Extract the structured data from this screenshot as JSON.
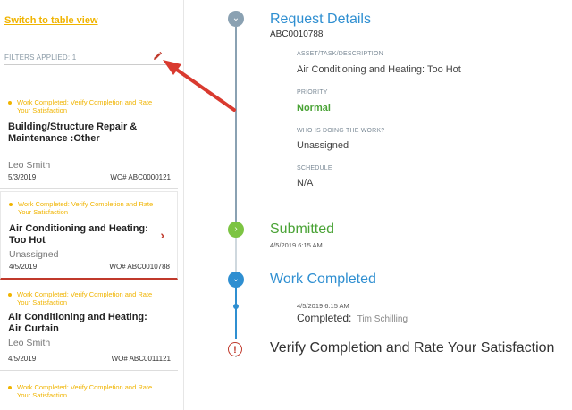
{
  "left_panel": {
    "switch_link": "Switch to table view",
    "filters_label": "FILTERS APPLIED: 1",
    "cards": [
      {
        "status": "Work Completed: Verify Completion and Rate Your Satisfaction",
        "title": "Building/Structure Repair & Maintenance :Other",
        "assignee": "Leo Smith",
        "date": "5/3/2019",
        "wo": "WO# ABC0000121"
      },
      {
        "status": "Work Completed: Verify Completion and Rate Your Satisfaction",
        "title": "Air Conditioning and Heating: Too Hot",
        "assignee": "Unassigned",
        "date": "4/5/2019",
        "wo": "WO# ABC0010788"
      },
      {
        "status": "Work Completed: Verify Completion and Rate Your Satisfaction",
        "title": "Air Conditioning and Heating: Air Curtain",
        "assignee": "Leo Smith",
        "date": "4/5/2019",
        "wo": "WO# ABC0011121"
      },
      {
        "status": "Work Completed: Verify Completion and Rate Your Satisfaction"
      }
    ]
  },
  "details": {
    "title": "Request Details",
    "request_id": "ABC0010788",
    "fields": [
      {
        "label": "ASSET/TASK/DESCRIPTION",
        "value": "Air Conditioning and Heating: Too Hot"
      },
      {
        "label": "PRIORITY",
        "value": "Normal"
      },
      {
        "label": "WHO IS DOING THE WORK?",
        "value": "Unassigned"
      },
      {
        "label": "SCHEDULE",
        "value": "N/A"
      }
    ]
  },
  "timeline": {
    "submitted": {
      "title": "Submitted",
      "timestamp": "4/5/2019 6:15 AM"
    },
    "work_completed": {
      "title": "Work Completed",
      "timestamp": "4/5/2019 6:15 AM",
      "completed_label": "Completed:",
      "completed_by": "Tim Schilling"
    },
    "verify": {
      "title": "Verify Completion and Rate Your Satisfaction"
    }
  },
  "colors": {
    "accent_yellow": "#f0b400",
    "priority_green": "#4aa336",
    "submitted_green": "#7cc443",
    "work_blue": "#2f8fd1",
    "alert_red": "#c0392b",
    "timeline_gray": "#8aa1b2"
  }
}
